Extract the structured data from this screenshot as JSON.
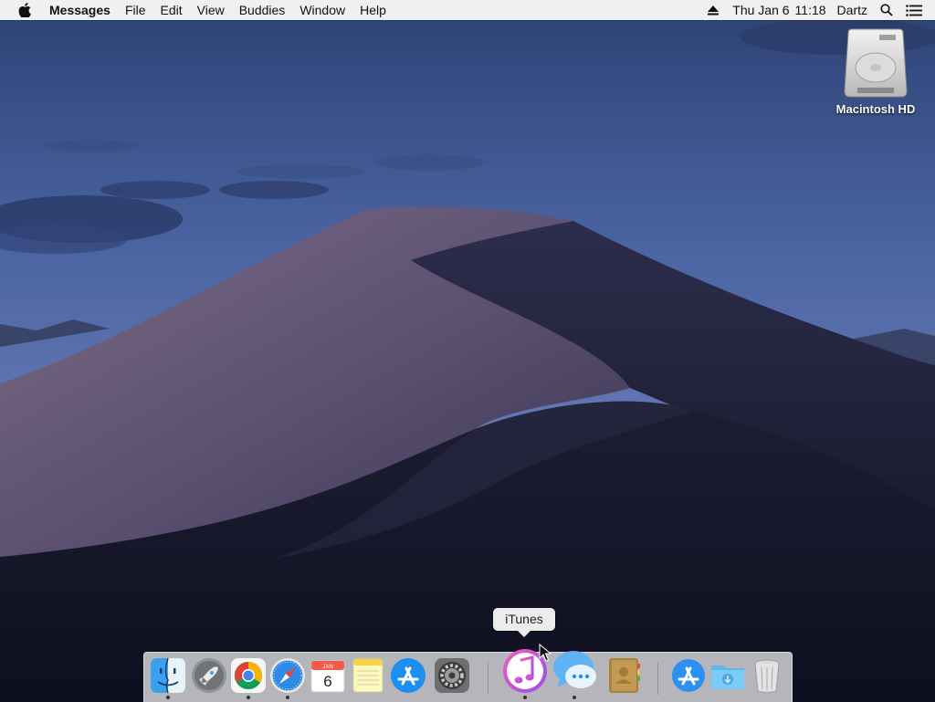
{
  "menubar": {
    "app_name": "Messages",
    "menus": [
      "File",
      "Edit",
      "View",
      "Buddies",
      "Window",
      "Help"
    ],
    "date": "Thu Jan 6",
    "time": "11:18",
    "user": "Dartz"
  },
  "desktop": {
    "disk_label": "Macintosh HD"
  },
  "tooltip": {
    "text": "iTunes"
  },
  "dock": {
    "calendar_month": "JAN",
    "calendar_day": "6",
    "items": [
      "finder-icon",
      "launchpad-icon",
      "chrome-icon",
      "safari-icon",
      "calendar-icon",
      "notes-icon",
      "app-store-icon",
      "system-preferences-icon",
      "itunes-icon",
      "messages-icon",
      "contacts-icon",
      "applications-folder-icon",
      "downloads-folder-icon",
      "trash-icon"
    ]
  }
}
